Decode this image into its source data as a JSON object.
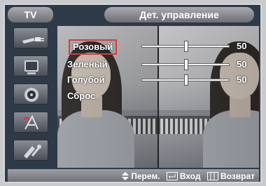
{
  "header": {
    "left_title": "TV",
    "menu_title": "Дет. управление"
  },
  "sidebar": {
    "items": [
      {
        "icon": "input-plug-icon",
        "selected": false
      },
      {
        "icon": "picture-icon",
        "selected": false
      },
      {
        "icon": "speaker-icon",
        "selected": false
      },
      {
        "icon": "channel-antenna-icon",
        "selected": false
      },
      {
        "icon": "settings-tools-icon",
        "selected": false
      }
    ]
  },
  "adjustments": [
    {
      "label": "Розовый",
      "value": "50",
      "level": 0.5,
      "selected": true
    },
    {
      "label": "Зеленый",
      "value": "50",
      "level": 0.5,
      "selected": false
    },
    {
      "label": "Голубой",
      "value": "50",
      "level": 0.5,
      "selected": false
    },
    {
      "label": "Сброс",
      "value": null,
      "level": null,
      "selected": false
    }
  ],
  "footer": {
    "move": "Перем.",
    "enter": "Вход",
    "return": "Возврат"
  },
  "colors": {
    "frame": "#2f3a48",
    "selection_border": "#d83a3a",
    "title_pill": "#8d8f95"
  }
}
